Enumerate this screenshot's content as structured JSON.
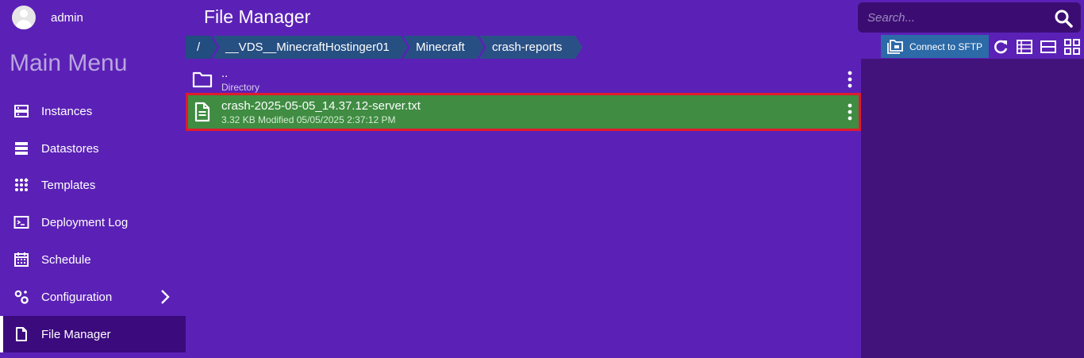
{
  "user": {
    "name": "admin"
  },
  "sidebar": {
    "title": "Main Menu",
    "items": [
      {
        "label": "Instances",
        "icon": "server-icon"
      },
      {
        "label": "Datastores",
        "icon": "database-icon"
      },
      {
        "label": "Templates",
        "icon": "apps-grid-icon"
      },
      {
        "label": "Deployment Log",
        "icon": "terminal-icon"
      },
      {
        "label": "Schedule",
        "icon": "calendar-icon"
      },
      {
        "label": "Configuration",
        "icon": "gears-icon"
      },
      {
        "label": "File Manager",
        "icon": "file-icon",
        "active": true
      }
    ]
  },
  "header": {
    "title": "File Manager",
    "search_placeholder": "Search..."
  },
  "breadcrumb": [
    "/",
    "__VDS__MinecraftHostinger01",
    "Minecraft",
    "crash-reports"
  ],
  "toolbar": {
    "sftp_label": "Connect to SFTP"
  },
  "files": [
    {
      "name": "..",
      "meta": "Directory",
      "type": "folder"
    },
    {
      "name": "crash-2025-05-05_14.37.12-server.txt",
      "meta": "3.32 KB Modified 05/05/2025 2:37:12 PM",
      "type": "file",
      "selected": true
    }
  ],
  "colors": {
    "background": "#5b21b6",
    "active_nav": "#3b0a7d",
    "selected_row": "#3f8c42",
    "selected_border": "#e01b2e",
    "breadcrumb": "#1e4a7c",
    "sftp_button": "#2c6aa8"
  }
}
